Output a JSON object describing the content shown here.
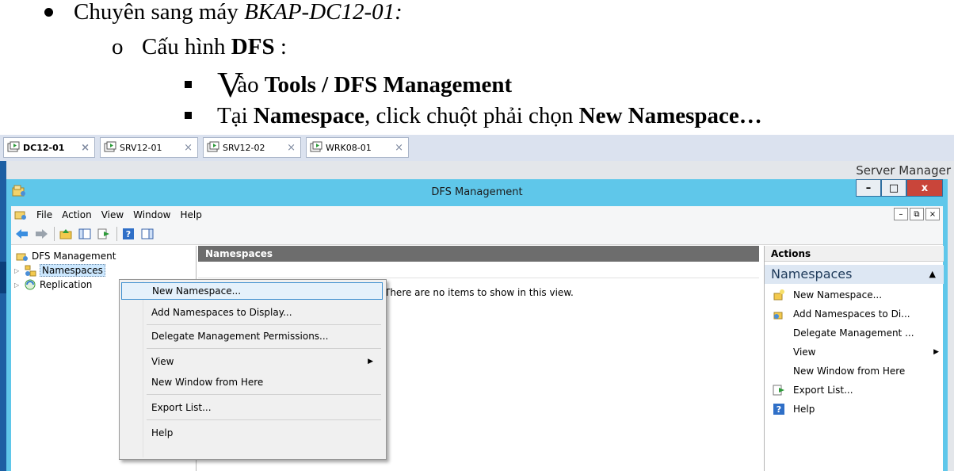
{
  "document": {
    "line1_prefix": "Chuyên sang máy ",
    "line1_host": "BKAP-DC12-01:",
    "line2_bullet": "o",
    "line2_prefix": "Cấu hình ",
    "line2_bold": "DFS",
    "line2_suffix": " :",
    "line3_big": "V",
    "line3_rest": "ào ",
    "line3_bold": "Tools / DFS Management",
    "line4_prefix": "Tại ",
    "line4_bold1": "Namespace",
    "line4_mid": ", click chuột phải chọn ",
    "line4_bold2": "New Namespace…"
  },
  "tabs": [
    {
      "label": "DC12-01",
      "close": "×"
    },
    {
      "label": "SRV12-01",
      "close": "×"
    },
    {
      "label": "SRV12-02",
      "close": "×"
    },
    {
      "label": "WRK08-01",
      "close": "×"
    }
  ],
  "host_title": "Server Manager",
  "window": {
    "title": "DFS Management",
    "menu": [
      "File",
      "Action",
      "View",
      "Window",
      "Help"
    ],
    "min": "–",
    "max": "□",
    "close": "x"
  },
  "tree": {
    "root": "DFS Management",
    "items": [
      "Namespaces",
      "Replication"
    ]
  },
  "middle": {
    "header": "Namespaces",
    "empty": "There are no items to show in this view."
  },
  "actions": {
    "header": "Actions",
    "section": "Namespaces",
    "items": [
      "New Namespace...",
      "Add Namespaces to Di...",
      "Delegate Management ...",
      "View",
      "New Window from Here",
      "Export List...",
      "Help"
    ]
  },
  "context_menu": {
    "items": [
      "New Namespace...",
      "Add Namespaces to Display...",
      "Delegate Management Permissions...",
      "View",
      "New Window from Here",
      "Export List...",
      "Help"
    ]
  },
  "colors": {
    "title_bar": "#5fc7ea",
    "highlight": "#e5f1fb",
    "pane_header": "#6d6d6d"
  }
}
